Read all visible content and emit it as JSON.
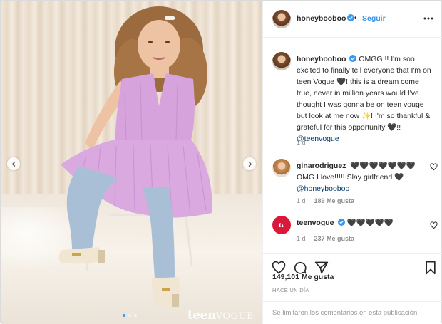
{
  "header": {
    "username": "honeybooboo",
    "bullet": "•",
    "follow_label": "Seguir"
  },
  "caption": {
    "username": "honeybooboo",
    "text": "OMGG !! I'm soo excited to finally tell everyone that I'm on teen Vogue 🖤! this is a dream come true, never in million years would I've thought I was gonna be on teen vouge but look at me now ✨! I'm so thankful & grateful for this opportunity 🖤!! ",
    "mention": "@teenvogue",
    "time": "1 d"
  },
  "comments": [
    {
      "username": "ginarodriguez",
      "text": "🖤🖤🖤🖤🖤🖤🖤 OMG I love!!!!! Slay girlfriend 🖤 ",
      "mention": "@honeybooboo",
      "time": "1 d",
      "likes": "189 Me gusta"
    },
    {
      "username": "teenvogue",
      "text": "🖤🖤🖤🖤🖤",
      "time": "1 d",
      "likes": "237 Me gusta"
    }
  ],
  "post": {
    "likes": "149,101 Me gusta",
    "timestamp": "HACE UN DÍA",
    "comments_disabled": "Se limitaron los comentarios en esta publicación."
  },
  "media": {
    "watermark_brand": "teen",
    "watermark_sub": "VOGUE",
    "carousel_index": 1,
    "carousel_count": 3
  },
  "colors": {
    "accent": "#3897f0",
    "verified": "#3897f0",
    "dress": "#d9a9e0",
    "jeans": "#a9bfd6",
    "teenvogue_brand": "#d8193a"
  },
  "icons": [
    "verified-badge-icon",
    "more-options-icon",
    "heart-icon",
    "comment-icon",
    "share-icon",
    "bookmark-icon",
    "chevron-left-icon",
    "chevron-right-icon"
  ]
}
